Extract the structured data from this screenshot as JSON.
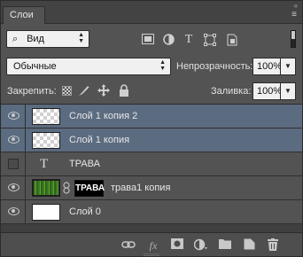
{
  "panel": {
    "tab_label": "Слои",
    "collapse_glyph": "«",
    "menu_glyph": "≡"
  },
  "filter": {
    "kind_value": "Вид",
    "icons": [
      "image-filter-icon",
      "adjustment-filter-icon",
      "type-filter-icon",
      "shape-filter-icon",
      "smart-object-filter-icon"
    ],
    "type_glyph": "T"
  },
  "blend": {
    "mode_value": "Обычные",
    "opacity_label": "Непрозрачность:",
    "opacity_value": "100%"
  },
  "lock": {
    "label": "Закрепить:",
    "fill_label": "Заливка:",
    "fill_value": "100%"
  },
  "layers": [
    {
      "name": "Слой 1 копия 2",
      "visible": true,
      "selected": true,
      "thumb": "transparent"
    },
    {
      "name": "Слой 1 копия",
      "visible": true,
      "selected": true,
      "thumb": "transparent"
    },
    {
      "name": "ТРАВА",
      "visible": false,
      "selected": false,
      "thumb": "type",
      "type_glyph": "T"
    },
    {
      "name": "трава1 копия",
      "visible": true,
      "selected": false,
      "thumb": "grass",
      "mask_text": "ТРАВА"
    },
    {
      "name": "Слой 0",
      "visible": true,
      "selected": false,
      "thumb": "white"
    }
  ],
  "bottom": {
    "fx_label": "fx",
    "icons": [
      "link-layers-icon",
      "fx-icon",
      "add-mask-icon",
      "adjustment-layer-icon",
      "new-group-icon",
      "new-layer-icon",
      "delete-layer-icon"
    ]
  },
  "colors": {
    "panel_bg": "#535353",
    "selected_row": "#5b6b80",
    "field_bg": "#f0f0f0"
  }
}
